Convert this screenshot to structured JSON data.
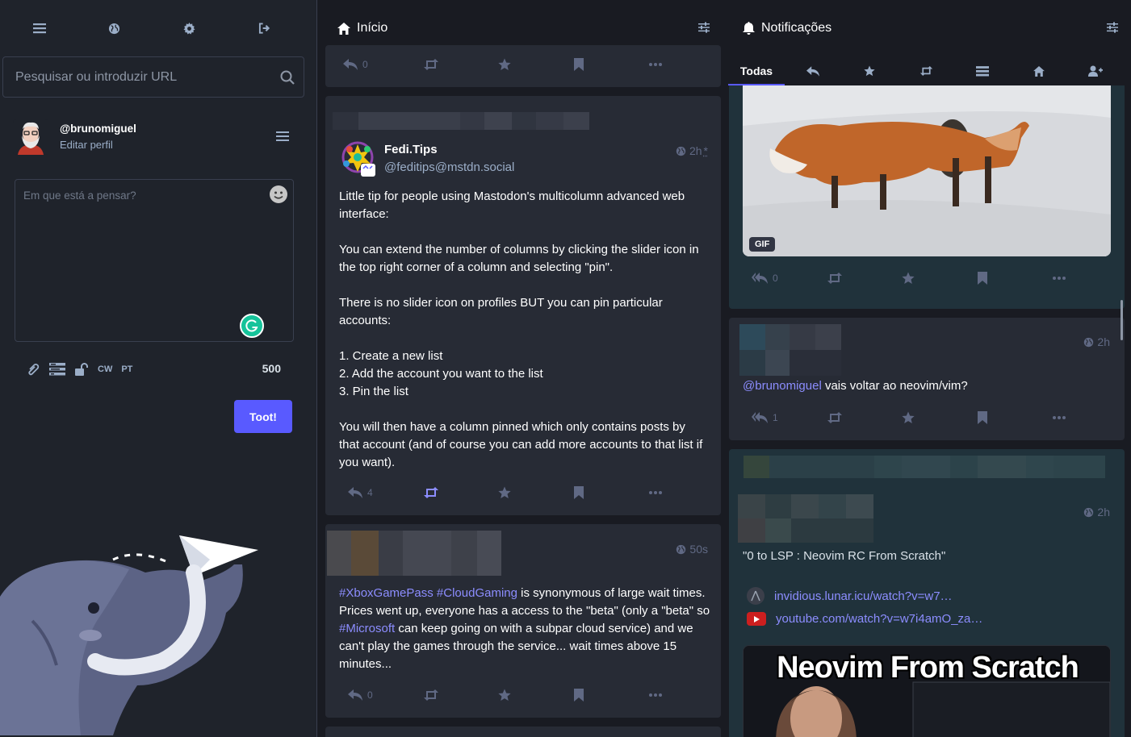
{
  "drawer": {
    "search_placeholder": "Pesquisar ou introduzir URL",
    "profile": {
      "handle": "@brunomiguel",
      "edit_label": "Editar perfil"
    },
    "compose": {
      "placeholder": "Em que está a pensar?",
      "cw_label": "CW",
      "language_label": "PT",
      "char_count": "500",
      "submit_label": "Toot!"
    }
  },
  "home": {
    "title": "Início",
    "top_partial": {
      "reply_count": "0"
    },
    "post1": {
      "display_name": "Fedi.Tips",
      "acct": "@feditips@mstdn.social",
      "time": "2h",
      "time_mark": "*",
      "paragraphs": [
        "Little tip for people using Mastodon's multicolumn advanced web interface:",
        "You can extend the number of columns by clicking the slider icon in the top right corner of a column and selecting \"pin\".",
        "There is no slider icon on profiles BUT you can pin particular accounts:"
      ],
      "list_lines": [
        "1. Create a new list",
        "2. Add the account you want to the list",
        "3. Pin the list"
      ],
      "closing": "You will then have a column pinned which only contains posts by that account (and of course you can add more accounts to that list if you want).",
      "reply_count": "4"
    },
    "post2": {
      "time": "50s",
      "hashtag1": "#XboxGamePass",
      "hashtag2": "#CloudGaming",
      "text1": " is synonymous of large wait times. Prices went up, everyone has a access to the \"beta\" (only a \"beta\" so ",
      "hashtag3": "#Microsoft",
      "text2": " can keep going on with a subpar cloud service) and we can't play the games through the service... wait times above 15 minutes...",
      "reply_count": "0"
    }
  },
  "notifications": {
    "title": "Notificações",
    "tab_all": "Todas",
    "card1": {
      "media_badge": "GIF",
      "reply_count": "0"
    },
    "card2": {
      "time": "2h",
      "mention": "@brunomiguel",
      "text": " vais voltar ao neovim/vim?",
      "reply_count": "1"
    },
    "card3": {
      "time": "2h",
      "quote": "\"0 to LSP : Neovim RC From Scratch\"",
      "link1": "invidious.lunar.icu/watch?v=w7…",
      "link2": "youtube.com/watch?v=w7i4amO_za…",
      "thumb_title": "Neovim From Scratch"
    }
  },
  "colors": {
    "accent": "#595aff",
    "link": "#8c8dff",
    "background": "#191b22",
    "card": "#272b35",
    "highlight_card": "#20323b"
  }
}
